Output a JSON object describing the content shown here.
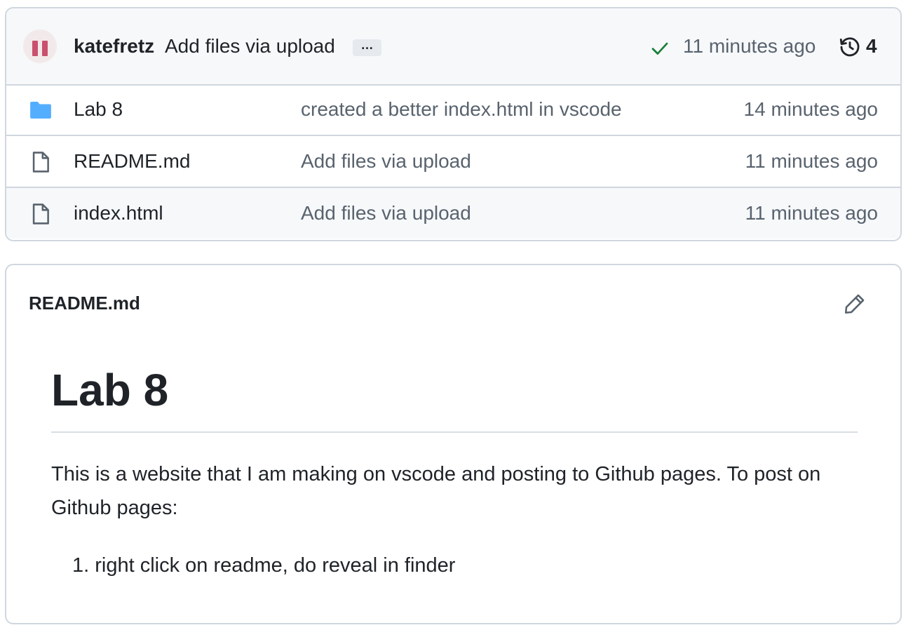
{
  "commit": {
    "author": "katefretz",
    "message": "Add files via upload",
    "ellipsis": "…",
    "time": "11 minutes ago",
    "history_count": "4"
  },
  "files": [
    {
      "type": "folder",
      "icon": "folder-icon",
      "name": "Lab 8",
      "message": "created a better index.html in vscode",
      "time": "14 minutes ago"
    },
    {
      "type": "file",
      "icon": "file-icon",
      "name": "README.md",
      "message": "Add files via upload",
      "time": "11 minutes ago"
    },
    {
      "type": "file",
      "icon": "file-icon",
      "name": "index.html",
      "message": "Add files via upload",
      "time": "11 minutes ago"
    }
  ],
  "readme": {
    "filename": "README.md",
    "heading": "Lab 8",
    "paragraph": "This is a website that I am making on vscode and posting to Github pages. To post on Github pages:",
    "list": [
      {
        "number": "1.",
        "text": "right click on readme, do reveal in finder"
      }
    ]
  },
  "colors": {
    "folder": "#54aeff",
    "check": "#1a7f37",
    "avatar": "#c9506e",
    "muted_text": "#59636e",
    "border": "#d0d7de"
  }
}
